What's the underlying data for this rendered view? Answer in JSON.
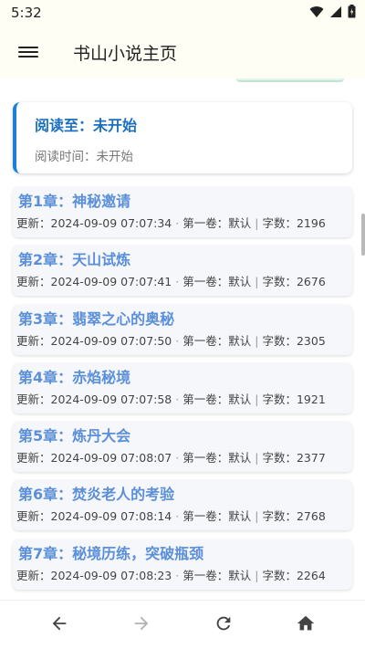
{
  "status_bar": {
    "time": "5:32",
    "icons": [
      "wifi-icon",
      "signal-icon",
      "battery-icon"
    ]
  },
  "app_bar": {
    "menu_icon": "hamburger-menu-icon",
    "title": "书山小说主页"
  },
  "reading_progress": {
    "title": "阅读至：未开始",
    "time": "阅读时间：未开始",
    "accent_color": "#1a7fd6"
  },
  "chapters": [
    {
      "title": "第1章：神秘邀请",
      "updated": "更新：2024-09-09 07:07:34",
      "volume": "第一卷：默认",
      "words": "字数：2196"
    },
    {
      "title": "第2章：天山试炼",
      "updated": "更新：2024-09-09 07:07:41",
      "volume": "第一卷：默认",
      "words": "字数：2676"
    },
    {
      "title": "第3章：翡翠之心的奥秘",
      "updated": "更新：2024-09-09 07:07:50",
      "volume": "第一卷：默认",
      "words": "字数：2305"
    },
    {
      "title": "第4章：赤焰秘境",
      "updated": "更新：2024-09-09 07:07:58",
      "volume": "第一卷：默认",
      "words": "字数：1921"
    },
    {
      "title": "第5章：炼丹大会",
      "updated": "更新：2024-09-09 07:08:07",
      "volume": "第一卷：默认",
      "words": "字数：2377"
    },
    {
      "title": "第6章：焚炎老人的考验",
      "updated": "更新：2024-09-09 07:08:14",
      "volume": "第一卷：默认",
      "words": "字数：2768"
    },
    {
      "title": "第7章：秘境历练，突破瓶颈",
      "updated": "更新：2024-09-09 07:08:23",
      "volume": "第一卷：默认",
      "words": "字数：2264"
    }
  ],
  "meta_separators": {
    "dot": "·",
    "pipe": "|"
  },
  "bottom_nav": {
    "buttons": [
      {
        "name": "back",
        "icon": "arrow-left-icon",
        "enabled": true
      },
      {
        "name": "forward",
        "icon": "arrow-right-icon",
        "enabled": false
      },
      {
        "name": "refresh",
        "icon": "refresh-icon",
        "enabled": true
      },
      {
        "name": "home",
        "icon": "home-icon",
        "enabled": true
      }
    ]
  },
  "colors": {
    "app_bar_bg": "#fffef4",
    "chapter_title": "#5b8fd9",
    "chapter_card_bg": "#f5f7fb"
  }
}
